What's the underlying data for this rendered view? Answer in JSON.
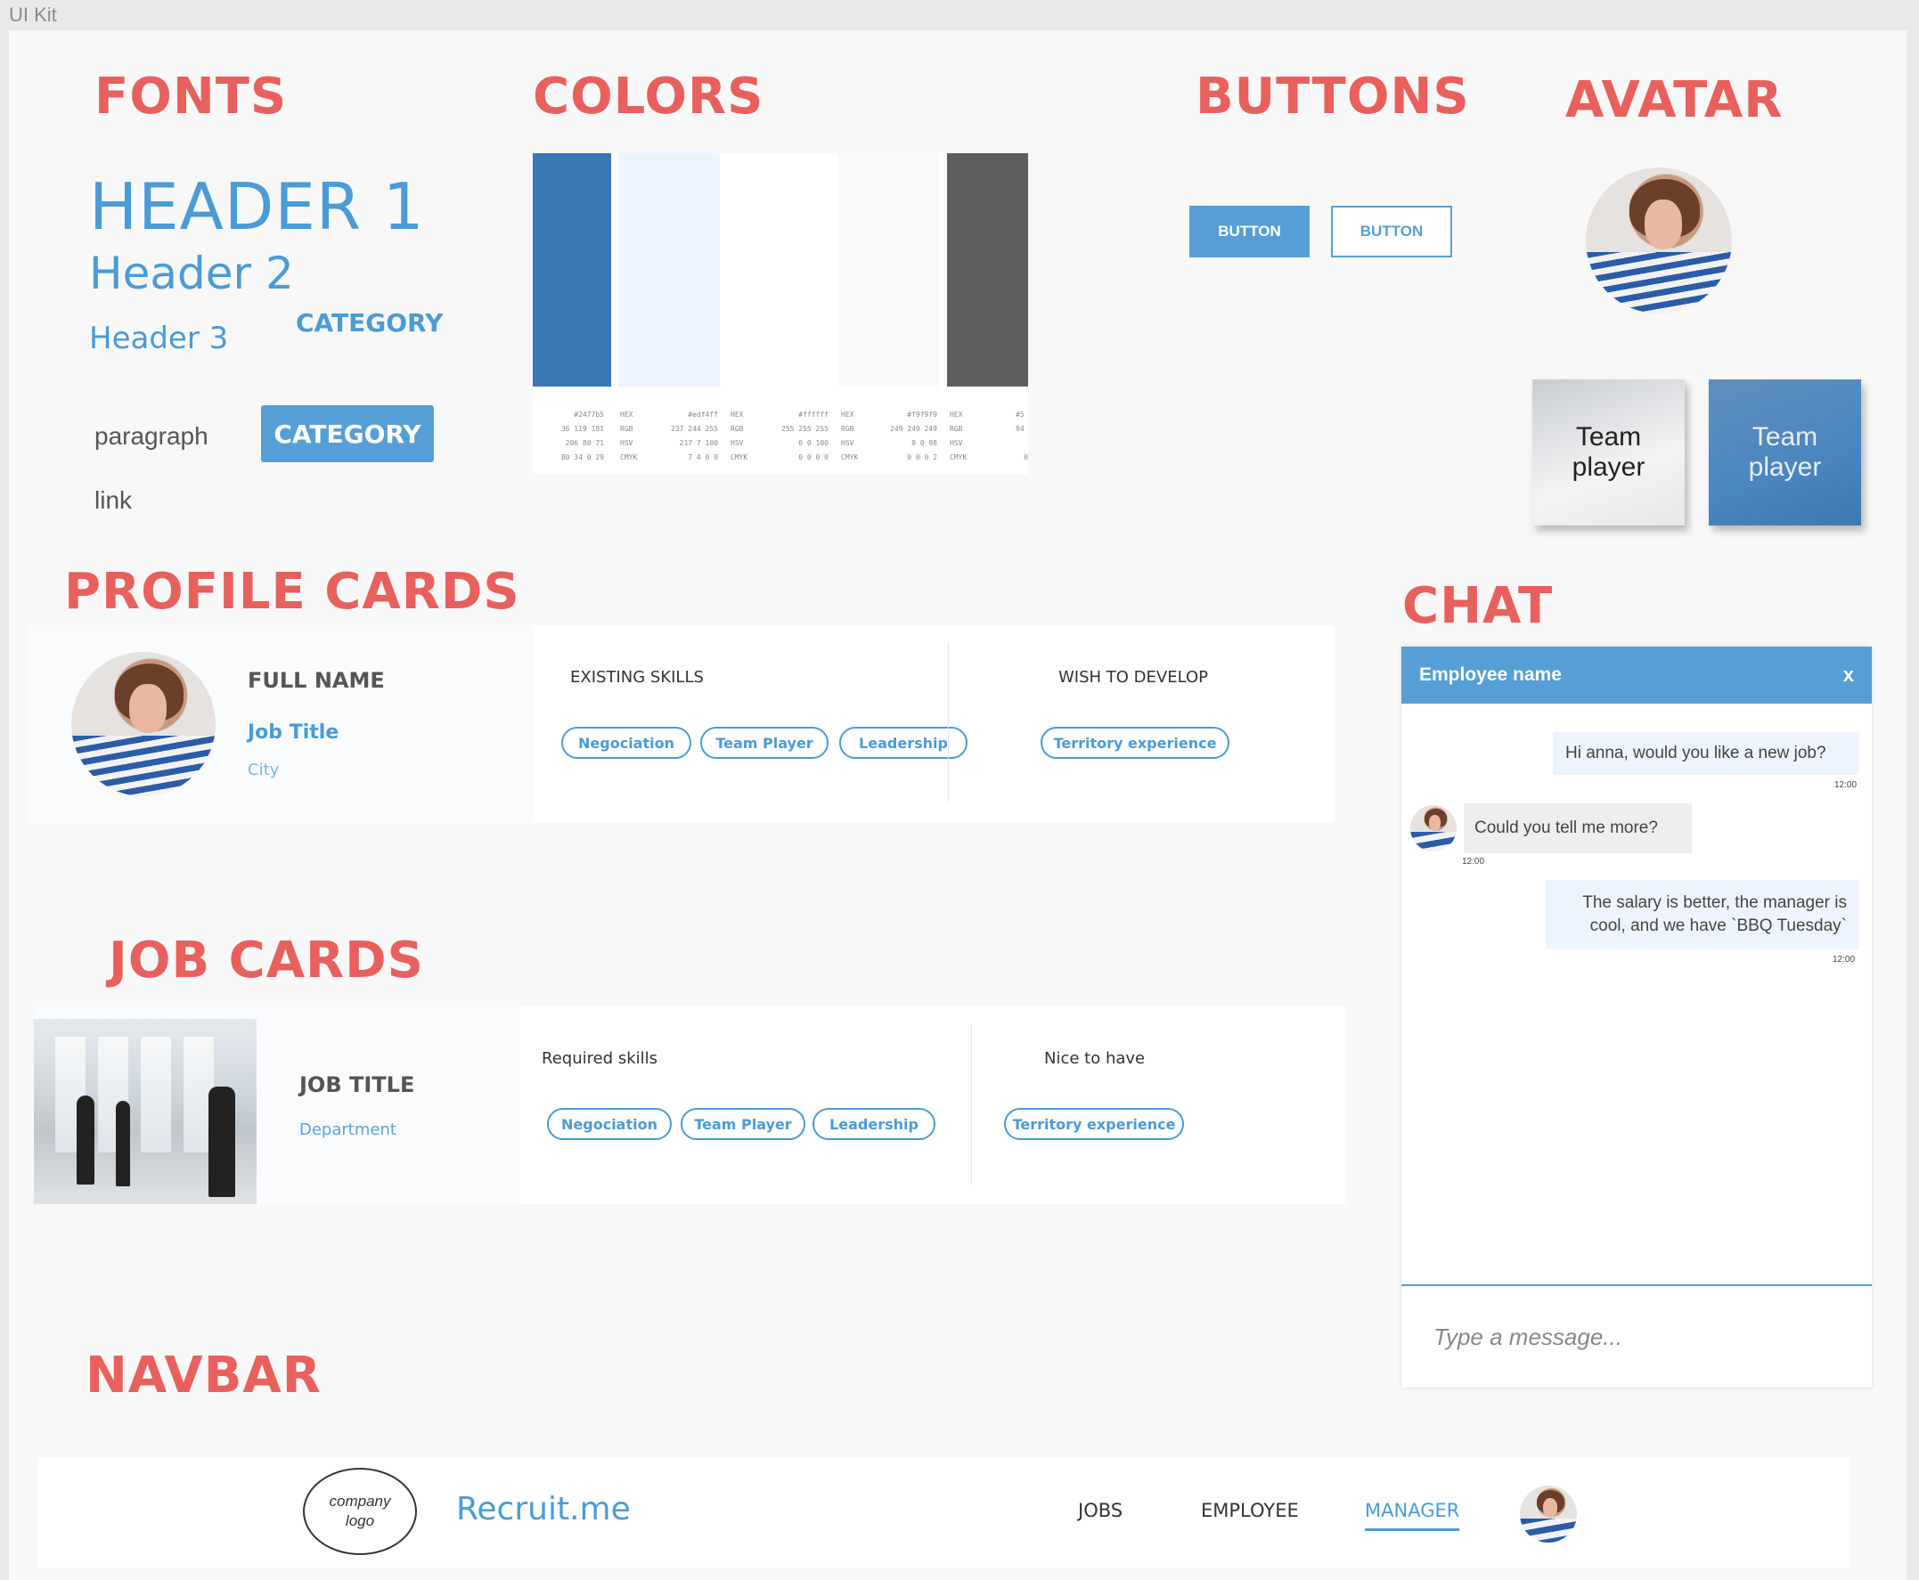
{
  "frame_label": "UI Kit",
  "sections": {
    "fonts": "FONTS",
    "colors": "COLORS",
    "buttons": "BUTTONS",
    "avatar": "AVATAR",
    "profile_cards": "PROFILE CARDS",
    "job_cards": "JOB CARDS",
    "chat": "CHAT",
    "navbar": "NAVBAR"
  },
  "fonts": {
    "header1": "HEADER 1",
    "header2": "Header 2",
    "header3": "Header 3",
    "category_text": "CATEGORY",
    "category_button": "CATEGORY",
    "paragraph": "paragraph",
    "link": "link"
  },
  "colors": {
    "swatches": [
      {
        "color": "#3a78b5",
        "hex": "#2477b5",
        "rgb": "36 119 181",
        "hsv": "206 80 71",
        "cmyk": "80 34 0 29"
      },
      {
        "color": "#edf4ff",
        "hex": "#edf4ff",
        "rgb": "237 244 255",
        "hsv": "217 7 100",
        "cmyk": "7 4 0 0"
      },
      {
        "color": "#ffffff",
        "hex": "#ffffff",
        "rgb": "255 255 255",
        "hsv": "0 0 100",
        "cmyk": "0 0 0 0"
      },
      {
        "color": "#f9f9f9",
        "hex": "#f9f9f9",
        "rgb": "249 249 249",
        "hsv": "0 0 98",
        "cmyk": "0 0 0 2"
      },
      {
        "color": "#5e5e5e",
        "hex": "#5",
        "rgb": "94",
        "hsv": "",
        "cmyk": "0"
      }
    ],
    "keys": {
      "hex": "HEX",
      "rgb": "RGB",
      "hsv": "HSV",
      "cmyk": "CMYK"
    }
  },
  "buttons": {
    "primary": "BUTTON",
    "outline": "BUTTON"
  },
  "tiles": {
    "light": "Team player",
    "dark": "Team player"
  },
  "profile_card": {
    "name": "FULL NAME",
    "job_title": "Job Title",
    "city": "City",
    "existing_skills_label": "EXISTING SKILLS",
    "existing_skills": [
      "Negociation",
      "Team Player",
      "Leadership"
    ],
    "wish_label": "WISH TO DEVELOP",
    "wish_skills": [
      "Territory experience"
    ]
  },
  "job_card": {
    "title": "JOB TITLE",
    "department": "Department",
    "required_label": "Required skills",
    "required_skills": [
      "Negociation",
      "Team Player",
      "Leadership"
    ],
    "nice_label": "Nice to have",
    "nice_skills": [
      "Territory experience"
    ]
  },
  "chat": {
    "header": "Employee name",
    "close": "x",
    "messages": [
      {
        "dir": "out",
        "text": "Hi anna, would you like a new job?",
        "time": "12:00"
      },
      {
        "dir": "in",
        "text": "Could you tell me more?",
        "time": "12:00"
      },
      {
        "dir": "out",
        "line1": "The salary is better, the manager is",
        "line2": "cool, and we have `BBQ Tuesday`",
        "time": "12:00"
      }
    ],
    "placeholder": "Type a message..."
  },
  "navbar": {
    "logo_line1": "company",
    "logo_line2": "logo",
    "brand": "Recruit.me",
    "items": [
      "JOBS",
      "EMPLOYEE",
      "MANAGER"
    ],
    "active": "MANAGER"
  },
  "accent_colors": {
    "section_title": "#e8605c",
    "primary": "#559fd6"
  }
}
